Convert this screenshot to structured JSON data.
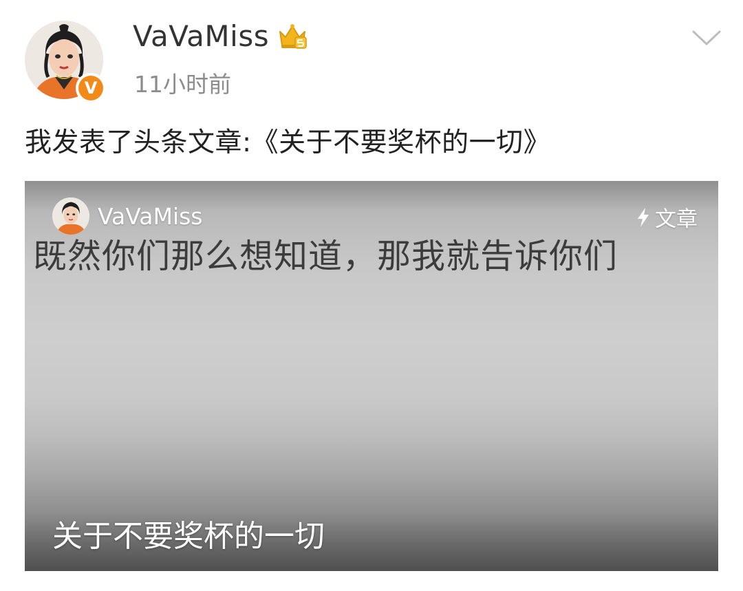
{
  "post": {
    "author": "VaVaMiss",
    "timestamp": "11小时前",
    "verified_badge": "V",
    "text": "我发表了头条文章:《关于不要奖杯的一切》",
    "icons": [
      "crown-icon",
      "chevron-down-icon",
      "verified-badge"
    ]
  },
  "article": {
    "author": "VaVaMiss",
    "type_label": "文章",
    "type_icon": "lightning-icon",
    "image_text": "既然你们那么想知道，那我就告诉你们",
    "title": "关于不要奖杯的一切"
  },
  "colors": {
    "verified": "#f28a1a",
    "crown": "#f2b51d",
    "username": "#333333",
    "timestamp": "#8c8c8c"
  }
}
